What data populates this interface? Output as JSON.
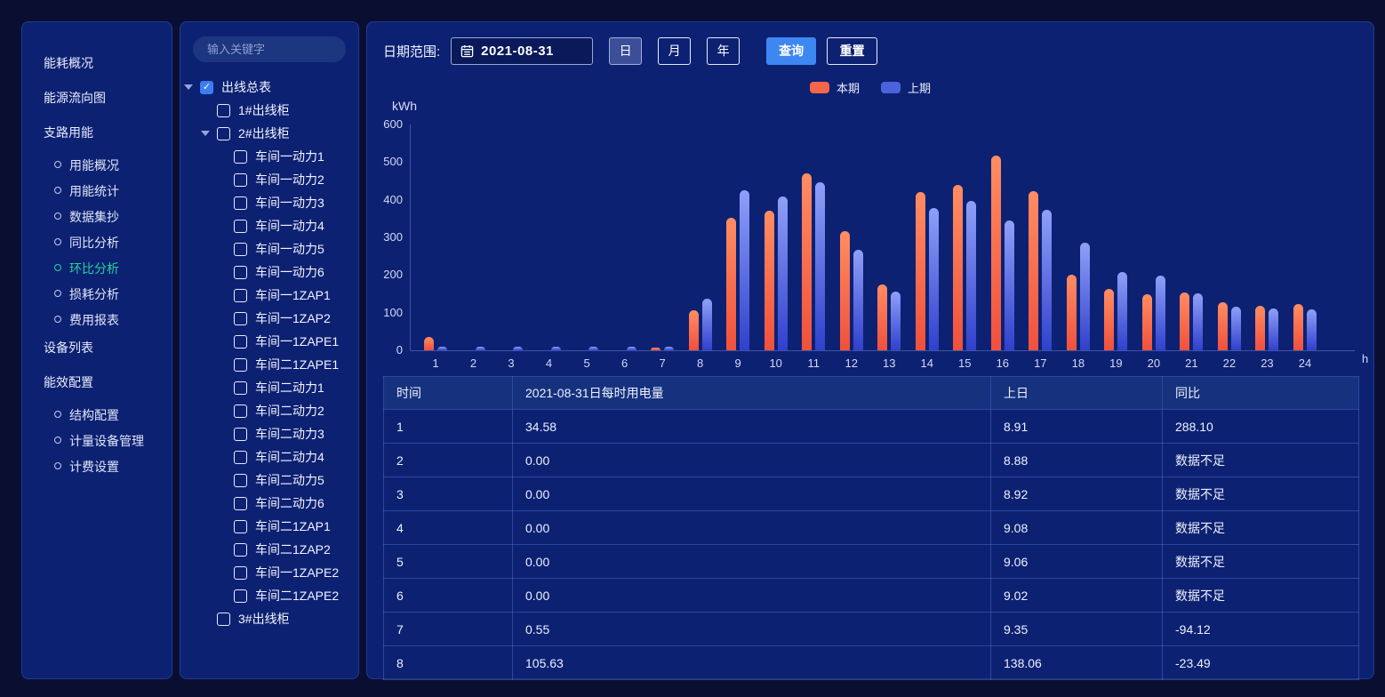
{
  "sidebar": {
    "items": [
      {
        "label": "能耗概况",
        "children": []
      },
      {
        "label": "能源流向图",
        "children": []
      },
      {
        "label": "支路用能",
        "children": [
          "用能概况",
          "用能统计",
          "数据集抄",
          "同比分析",
          "环比分析",
          "损耗分析",
          "费用报表"
        ]
      },
      {
        "label": "设备列表",
        "children": []
      },
      {
        "label": "能效配置",
        "children": [
          "结构配置",
          "计量设备管理",
          "计费设置"
        ]
      }
    ],
    "active_item": "环比分析",
    "active_color": "#1fd79b"
  },
  "tree": {
    "search_placeholder": "输入关键字",
    "nodes": [
      {
        "label": "出线总表",
        "level": 0,
        "checked": true,
        "expanded": true
      },
      {
        "label": "1#出线柜",
        "level": 1,
        "checked": false,
        "expanded": null
      },
      {
        "label": "2#出线柜",
        "level": 1,
        "checked": false,
        "expanded": true
      },
      {
        "label": "车间一动力1",
        "level": 2,
        "checked": false,
        "expanded": null
      },
      {
        "label": "车间一动力2",
        "level": 2,
        "checked": false,
        "expanded": null
      },
      {
        "label": "车间一动力3",
        "level": 2,
        "checked": false,
        "expanded": null
      },
      {
        "label": "车间一动力4",
        "level": 2,
        "checked": false,
        "expanded": null
      },
      {
        "label": "车间一动力5",
        "level": 2,
        "checked": false,
        "expanded": null
      },
      {
        "label": "车间一动力6",
        "level": 2,
        "checked": false,
        "expanded": null
      },
      {
        "label": "车间一1ZAP1",
        "level": 2,
        "checked": false,
        "expanded": null
      },
      {
        "label": "车间一1ZAP2",
        "level": 2,
        "checked": false,
        "expanded": null
      },
      {
        "label": "车间一1ZAPE1",
        "level": 2,
        "checked": false,
        "expanded": null
      },
      {
        "label": "车间二1ZAPE1",
        "level": 2,
        "checked": false,
        "expanded": null
      },
      {
        "label": "车间二动力1",
        "level": 2,
        "checked": false,
        "expanded": null
      },
      {
        "label": "车间二动力2",
        "level": 2,
        "checked": false,
        "expanded": null
      },
      {
        "label": "车间二动力3",
        "level": 2,
        "checked": false,
        "expanded": null
      },
      {
        "label": "车间二动力4",
        "level": 2,
        "checked": false,
        "expanded": null
      },
      {
        "label": "车间二动力5",
        "level": 2,
        "checked": false,
        "expanded": null
      },
      {
        "label": "车间二动力6",
        "level": 2,
        "checked": false,
        "expanded": null
      },
      {
        "label": "车间二1ZAP1",
        "level": 2,
        "checked": false,
        "expanded": null
      },
      {
        "label": "车间二1ZAP2",
        "level": 2,
        "checked": false,
        "expanded": null
      },
      {
        "label": "车间一1ZAPE2",
        "level": 2,
        "checked": false,
        "expanded": null
      },
      {
        "label": "车间二1ZAPE2",
        "level": 2,
        "checked": false,
        "expanded": null
      },
      {
        "label": "3#出线柜",
        "level": 1,
        "checked": false,
        "expanded": null
      }
    ]
  },
  "toolbar": {
    "date_label": "日期范围:",
    "date_value": "2021-08-31",
    "period_buttons": [
      "日",
      "月",
      "年"
    ],
    "active_period": "日",
    "query_label": "查询",
    "reset_label": "重置"
  },
  "chart_data": {
    "type": "bar",
    "title": "",
    "ylabel": "kWh",
    "xlabel": "h",
    "ylim": [
      0,
      600
    ],
    "yticks": [
      0,
      100,
      200,
      300,
      400,
      500,
      600
    ],
    "grid": false,
    "legend_position": "top-center",
    "categories": [
      1,
      2,
      3,
      4,
      5,
      6,
      7,
      8,
      9,
      10,
      11,
      12,
      13,
      14,
      15,
      16,
      17,
      18,
      19,
      20,
      21,
      22,
      23,
      24
    ],
    "series": [
      {
        "name": "本期",
        "color": "#f4664a",
        "values": [
          34.58,
          0,
          0,
          0,
          0,
          0,
          0.55,
          105.63,
          352,
          372,
          469,
          317,
          176,
          420,
          440,
          518,
          422,
          202,
          162,
          149,
          153,
          127,
          118,
          123
        ]
      },
      {
        "name": "上期",
        "color": "#4a63dd",
        "values": [
          8.91,
          8.88,
          8.92,
          9.08,
          9.06,
          9.02,
          9.35,
          138.06,
          426,
          409,
          446,
          266,
          155,
          377,
          397,
          346,
          373,
          287,
          207,
          199,
          151,
          116,
          112,
          108
        ]
      }
    ]
  },
  "table": {
    "columns": [
      "时间",
      "2021-08-31日每时用电量",
      "上日",
      "同比"
    ],
    "rows": [
      [
        "1",
        "34.58",
        "8.91",
        "288.10"
      ],
      [
        "2",
        "0.00",
        "8.88",
        "数据不足"
      ],
      [
        "3",
        "0.00",
        "8.92",
        "数据不足"
      ],
      [
        "4",
        "0.00",
        "9.08",
        "数据不足"
      ],
      [
        "5",
        "0.00",
        "9.06",
        "数据不足"
      ],
      [
        "6",
        "0.00",
        "9.02",
        "数据不足"
      ],
      [
        "7",
        "0.55",
        "9.35",
        "-94.12"
      ],
      [
        "8",
        "105.63",
        "138.06",
        "-23.49"
      ]
    ]
  }
}
